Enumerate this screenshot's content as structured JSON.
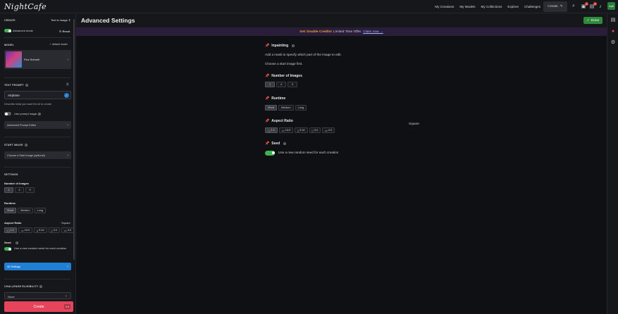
{
  "brand": "NightCafe",
  "nav": {
    "items": [
      "My Creations",
      "My Models",
      "My Collections",
      "Explore",
      "Challenges"
    ],
    "create_label": "Create",
    "badges": {
      "notifications_a": "1",
      "notifications_b": "4"
    },
    "avatar_text": "Lv4"
  },
  "sidebar": {
    "create_title": "CREATE",
    "mode_select": "Text to image",
    "advanced_mode_label": "Advanced mode",
    "reset_label": "Reset",
    "model_title": "MODEL",
    "default_model_label": "default model",
    "model_name": "Flux Schnell",
    "text_prompt_title": "TEXT PROMPT",
    "prompt_value": "Airplane",
    "prompt_hint": "Describe what you want the AI to create.",
    "prompt_magic_label": "Use prompt magic",
    "advanced_prompt_editor": "Advanced Prompt Editor",
    "start_image_title": "START IMAGE",
    "start_image_button": "Choose a Start Image (optional)",
    "settings_title": "SETTINGS",
    "num_images_label": "Number of Images",
    "num_images_options": [
      "1",
      "4",
      "9"
    ],
    "runtime_label": "Runtime",
    "runtime_options": [
      "Short",
      "Medium",
      "Long"
    ],
    "aspect_ratio_label": "Aspect Ratio",
    "aspect_ratio_value": "Square",
    "aspect_options": [
      "1:1",
      "16:9",
      "9:16",
      "3:4",
      "4:3"
    ],
    "seed_label": "Seed",
    "seed_text": "Use a new random seed for each creation",
    "all_settings": "All Settings",
    "challenge_title": "CHALLENGE ELIGIBILITY",
    "challenge_select": "None",
    "create_button": "Create",
    "create_cost": "0.5"
  },
  "main": {
    "title": "Advanced Settings",
    "done_label": "Done",
    "promo": {
      "prefix": "Get",
      "highlight": "Double Credits!",
      "middle": "Limited Time Offer.",
      "link": "Claim now →"
    },
    "inpainting_label": "Inpainting",
    "inpainting_text": "Add a mask to specify which part of the image to edit.",
    "inpainting_hint": "Choose a start image first.",
    "num_images_label": "Number of Images",
    "num_images_options": [
      "1",
      "4",
      "9"
    ],
    "runtime_label": "Runtime",
    "runtime_options": [
      "Short",
      "Medium",
      "Long"
    ],
    "aspect_ratio_label": "Aspect Ratio",
    "aspect_ratio_value": "Square",
    "aspect_options": [
      "1:1",
      "16:9",
      "9:16",
      "3:4",
      "4:3"
    ],
    "seed_label": "Seed",
    "seed_text": "Use a new random seed for each creation"
  },
  "colors": {
    "accent_green": "#3fb34f",
    "create_red": "#e6445a",
    "info_blue": "#1e7fd4",
    "promo_orange": "#f0a03a"
  }
}
